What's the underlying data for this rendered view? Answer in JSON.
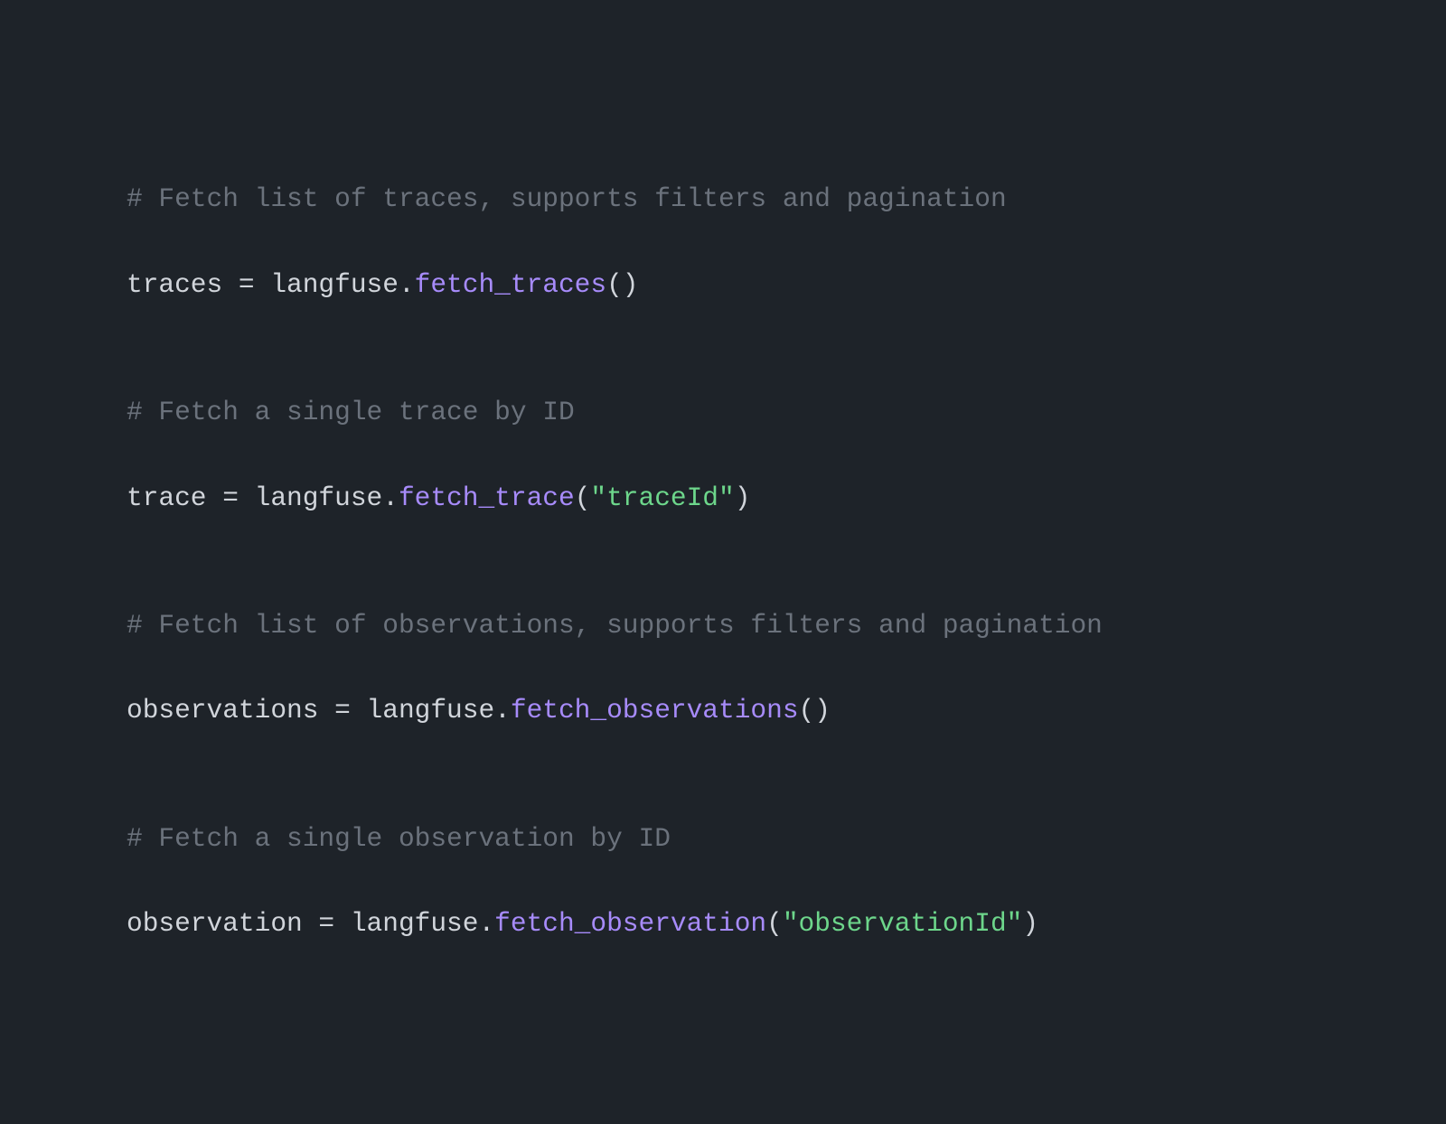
{
  "code": {
    "comment1": "# Fetch list of traces, supports filters and pagination",
    "line1": {
      "var": "traces",
      "op": " = ",
      "obj": "langfuse",
      "dot": ".",
      "fn": "fetch_traces",
      "open": "(",
      "close": ")"
    },
    "comment2": "# Fetch a single trace by ID",
    "line2": {
      "var": "trace",
      "op": " = ",
      "obj": "langfuse",
      "dot": ".",
      "fn": "fetch_trace",
      "open": "(",
      "str": "\"traceId\"",
      "close": ")"
    },
    "comment3": "# Fetch list of observations, supports filters and pagination",
    "line3": {
      "var": "observations",
      "op": " = ",
      "obj": "langfuse",
      "dot": ".",
      "fn": "fetch_observations",
      "open": "(",
      "close": ")"
    },
    "comment4": "# Fetch a single observation by ID",
    "line4": {
      "var": "observation",
      "op": " = ",
      "obj": "langfuse",
      "dot": ".",
      "fn": "fetch_observation",
      "open": "(",
      "str": "\"observationId\"",
      "close": ")"
    }
  }
}
